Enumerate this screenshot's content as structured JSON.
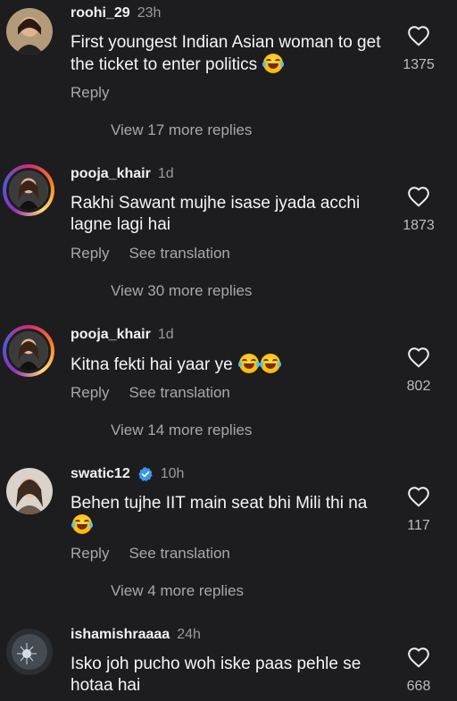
{
  "comments": [
    {
      "username": "roohi_29",
      "time": "23h",
      "text": "First youngest Indian Asian woman to get the ticket to enter politics",
      "likes": "1375",
      "reply": "Reply",
      "view_more": "View 17 more replies"
    },
    {
      "username": "pooja_khair",
      "time": "1d",
      "text": "Rakhi Sawant mujhe isase jyada acchi lagne lagi hai",
      "likes": "1873",
      "reply": "Reply",
      "translate": "See translation",
      "view_more": "View 30 more replies"
    },
    {
      "username": "pooja_khair",
      "time": "1d",
      "text": "Kitna fekti hai yaar ye",
      "likes": "802",
      "reply": "Reply",
      "translate": "See translation",
      "view_more": "View 14 more replies"
    },
    {
      "username": "swatic12",
      "time": "10h",
      "verified": true,
      "text": "Behen tujhe IIT main seat bhi Mili thi na",
      "likes": "117",
      "reply": "Reply",
      "translate": "See translation",
      "view_more": "View 4 more replies"
    },
    {
      "username": "ishamishraaaa",
      "time": "24h",
      "text": "Isko joh pucho woh iske paas pehle se hotaa hai",
      "likes": "668"
    }
  ],
  "icons": {
    "like": "heart-icon",
    "emoji": "face-with-tears-of-joy-emoji",
    "verified": "verified-badge-icon"
  },
  "colors": {
    "background": "#1d1d1f",
    "verified": "#3897f0"
  }
}
